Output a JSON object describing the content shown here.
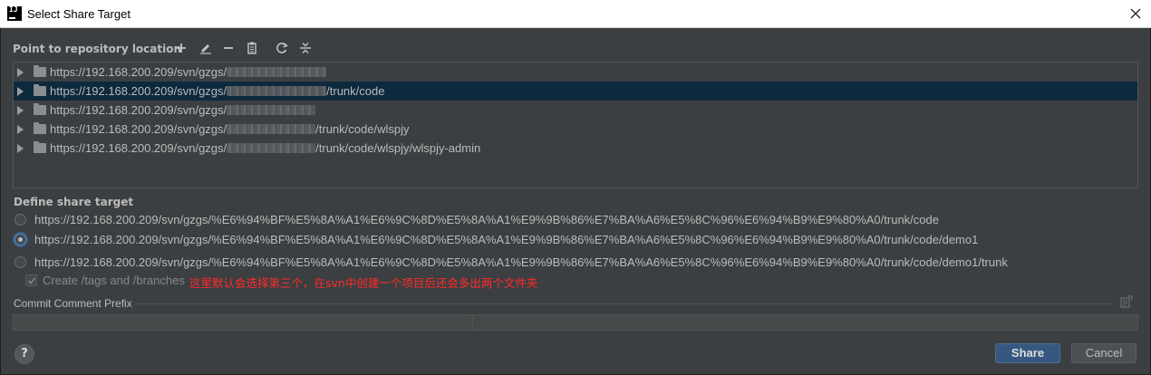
{
  "window": {
    "title": "Select Share Target",
    "app_icon_text": "IJ"
  },
  "repo_section": {
    "label": "Point to repository location",
    "toolbar_icons": [
      "add-icon",
      "edit-icon",
      "remove-icon",
      "clipboard-icon",
      "refresh-icon",
      "collapse-icon"
    ]
  },
  "tree": {
    "rows": [
      {
        "prefix": "https://192.168.200.209/svn/gzgs/",
        "suffix": "",
        "selected": false
      },
      {
        "prefix": "https://192.168.200.209/svn/gzgs/",
        "suffix": "/trunk/code",
        "selected": true
      },
      {
        "prefix": "https://192.168.200.209/svn/gzgs/",
        "suffix": "",
        "selected": false
      },
      {
        "prefix": "https://192.168.200.209/svn/gzgs/",
        "suffix": "/trunk/code/wlspjy",
        "selected": false
      },
      {
        "prefix": "https://192.168.200.209/svn/gzgs/",
        "suffix": "/trunk/code/wlspjy/wlspjy-admin",
        "selected": false
      }
    ]
  },
  "target_section": {
    "label": "Define share target",
    "options": [
      {
        "text": "https://192.168.200.209/svn/gzgs/%E6%94%BF%E5%8A%A1%E6%9C%8D%E5%8A%A1%E9%9B%86%E7%BA%A6%E5%8C%96%E6%94%B9%E9%80%A0/trunk/code",
        "checked": false
      },
      {
        "text": "https://192.168.200.209/svn/gzgs/%E6%94%BF%E5%8A%A1%E6%9C%8D%E5%8A%A1%E9%9B%86%E7%BA%A6%E5%8C%96%E6%94%B9%E9%80%A0/trunk/code/demo1",
        "checked": true
      },
      {
        "text": "https://192.168.200.209/svn/gzgs/%E6%94%BF%E5%8A%A1%E6%9C%8D%E5%8A%A1%E9%9B%86%E7%BA%A6%E5%8C%96%E6%94%B9%E9%80%A0/trunk/code/demo1/trunk",
        "checked": false
      }
    ],
    "create_dirs_label": "Create /tags and /branches",
    "create_dirs_checked": true,
    "annotation": "这里默认会选择第三个，在svn中创建一个项目后还会多出两个文件夹"
  },
  "commit": {
    "label": "Commit Comment Prefix",
    "value": ""
  },
  "buttons": {
    "help": "?",
    "share": "Share",
    "cancel": "Cancel"
  }
}
